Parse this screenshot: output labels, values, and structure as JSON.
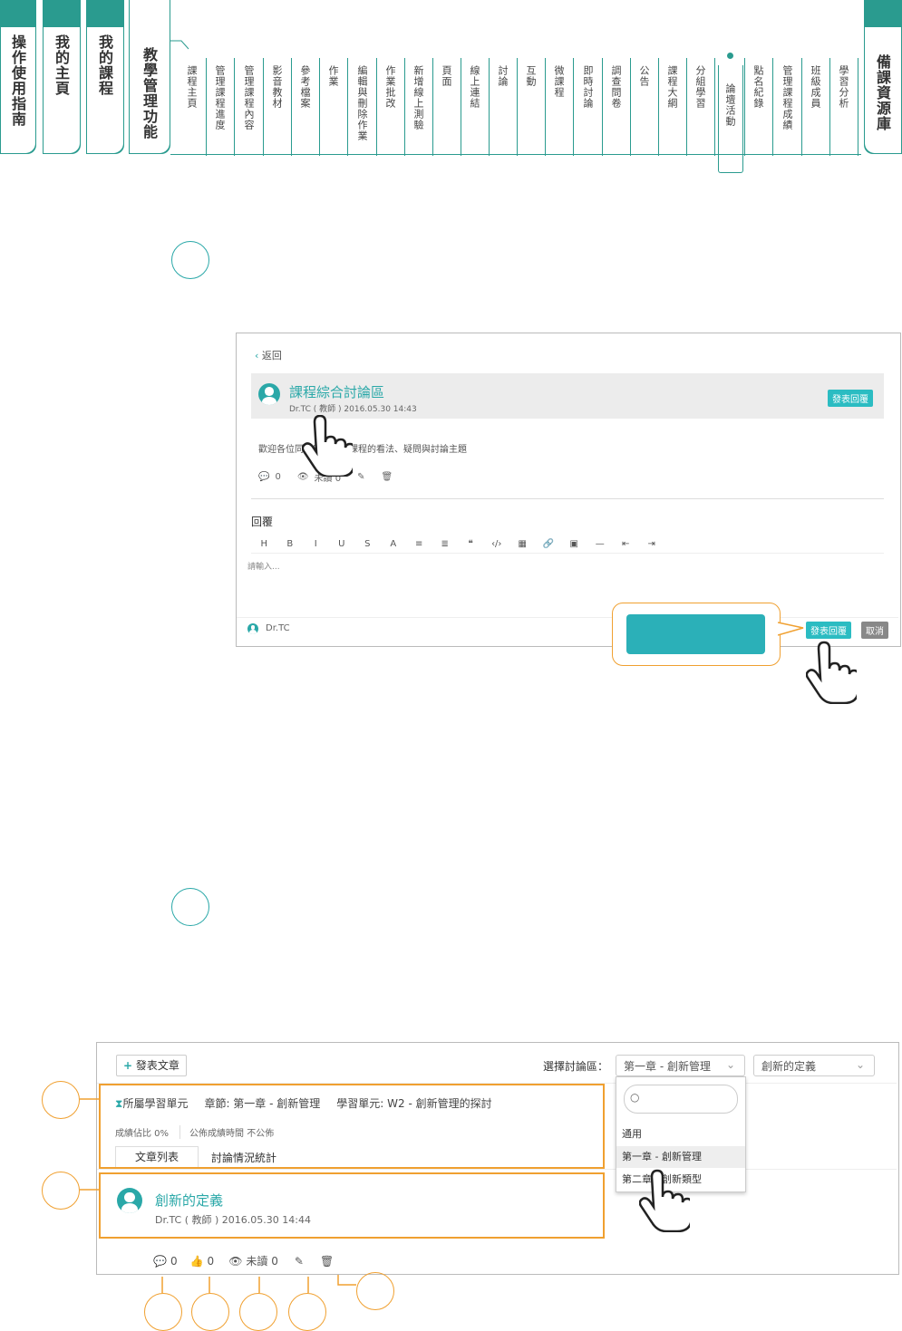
{
  "nav": {
    "tabs": [
      {
        "label": "操作使用指南"
      },
      {
        "label": "我的主頁"
      },
      {
        "label": "我的課程"
      },
      {
        "label": "教學管理功能"
      }
    ],
    "menu": [
      "課程主頁",
      "管理課程進度",
      "管理課程內容",
      "影音教材",
      "參考檔案",
      "作業",
      "編輯與刪除作業",
      "作業批改",
      "新增線上測驗",
      "頁面",
      "線上連結",
      "討論",
      "互動",
      "微課程",
      "即時討論",
      "調查問卷",
      "公告",
      "課程大綱",
      "分組學習",
      "論壇活動",
      "點名紀錄",
      "管理課程成績",
      "班級成員",
      "學習分析"
    ],
    "active_menu": "論壇活動",
    "right_tab": "備課資源庫"
  },
  "reply_panel": {
    "back": "返回",
    "title": "課程綜合討論區",
    "meta": "Dr.TC ( 教師 ) 2016.05.30 14:43",
    "post_reply_button": "發表回覆",
    "body": "歡迎各位同學留下你對課程的看法、疑問與討論主題",
    "comments": "0",
    "unread": "未讀 0",
    "reply_label": "回覆",
    "toolbar": [
      "H",
      "B",
      "I",
      "U",
      "S",
      "A",
      "≡",
      "≣",
      "❝",
      "‹/›",
      "▦",
      "🔗",
      "▣",
      "—",
      "⇤",
      "⇥"
    ],
    "editor_placeholder": "請輸入...",
    "user": "Dr.TC",
    "submit": "發表回覆",
    "cancel": "取消"
  },
  "forum_panel": {
    "post_article": "發表文章",
    "select_label": "選擇討論區：",
    "select_value": "第一章 - 創新管理",
    "topic_value": "創新的定義",
    "unit_label": "所屬學習單元",
    "chapter": "章節: 第一章 - 創新管理",
    "learning_unit": "學習單元: W2 - 創新管理的探討",
    "score_ratio": "成績佔比 0%",
    "publish_time": "公佈成績時間 不公佈",
    "tab_list": "文章列表",
    "tab_stats": "討論情況統計",
    "dropdown_options": [
      "通用",
      "第一章 - 創新管理",
      "第二章 - 創新類型"
    ],
    "post_title": "創新的定義",
    "post_meta": "Dr.TC ( 教師 ) 2016.05.30 14:44",
    "comments": "0",
    "likes": "0",
    "unread": "未讀 0"
  }
}
